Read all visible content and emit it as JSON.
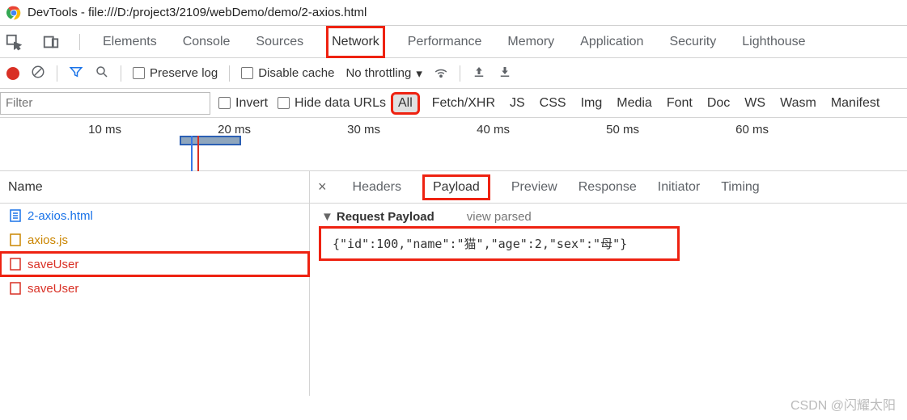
{
  "window": {
    "title": "DevTools - file:///D:/project3/2109/webDemo/demo/2-axios.html"
  },
  "maintabs": {
    "elements": "Elements",
    "console": "Console",
    "sources": "Sources",
    "network": "Network",
    "performance": "Performance",
    "memory": "Memory",
    "application": "Application",
    "security": "Security",
    "lighthouse": "Lighthouse"
  },
  "toolbar": {
    "preserve_log": "Preserve log",
    "disable_cache": "Disable cache",
    "throttling": "No throttling"
  },
  "filter": {
    "placeholder": "Filter",
    "invert": "Invert",
    "hide_data_urls": "Hide data URLs",
    "types": {
      "all": "All",
      "fetchxhr": "Fetch/XHR",
      "js": "JS",
      "css": "CSS",
      "img": "Img",
      "media": "Media",
      "font": "Font",
      "doc": "Doc",
      "ws": "WS",
      "wasm": "Wasm",
      "manifest": "Manifest"
    }
  },
  "timeline": {
    "ticks": [
      "10 ms",
      "20 ms",
      "30 ms",
      "40 ms",
      "50 ms",
      "60 ms"
    ]
  },
  "name_panel": {
    "header": "Name",
    "rows": [
      {
        "label": "2-axios.html"
      },
      {
        "label": "axios.js"
      },
      {
        "label": "saveUser"
      },
      {
        "label": "saveUser"
      }
    ]
  },
  "detail": {
    "tabs": {
      "headers": "Headers",
      "payload": "Payload",
      "preview": "Preview",
      "response": "Response",
      "initiator": "Initiator",
      "timing": "Timing"
    },
    "request_payload_label": "Request Payload",
    "view_parsed": "view parsed",
    "payload_content": "{\"id\":100,\"name\":\"猫\",\"age\":2,\"sex\":\"母\"}"
  },
  "watermark": "CSDN @闪耀太阳"
}
